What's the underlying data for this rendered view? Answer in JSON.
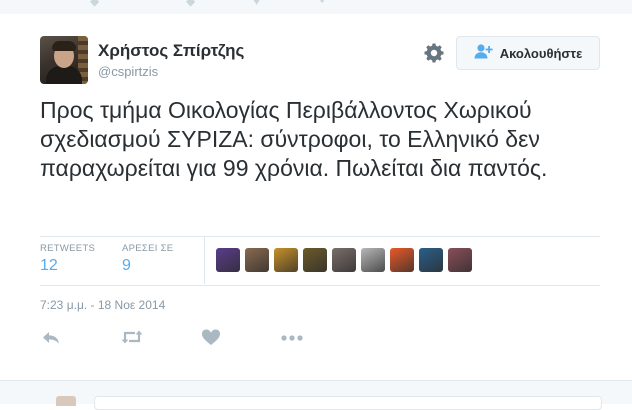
{
  "user": {
    "fullname": "Χρήστος Σπίρτζης",
    "username": "@cspirtzis"
  },
  "follow_button": {
    "label": "Ακολουθήστε"
  },
  "tweet": {
    "text": "Προς τμήμα Οικολογίας Περιβάλλοντος Χωρικού σχεδιασμού ΣΥΡΙΖΑ: σύντροφοι,  το Ελληνικό δεν παραχωρείται για 99 χρόνια. Πωλείται δια παντός.",
    "timestamp": "7:23 μ.μ. - 18 Νοε 2014"
  },
  "stats": {
    "retweets_label": "RETWEETS",
    "retweets_count": "12",
    "likes_label": "ΑΡΕΣΕΙ ΣΕ",
    "likes_count": "9"
  },
  "favoriters": [
    {
      "name": "favoriter-1",
      "color": "#5a3d8a"
    },
    {
      "name": "favoriter-2",
      "color": "#8a6a4f"
    },
    {
      "name": "favoriter-3",
      "color": "#c7902a"
    },
    {
      "name": "favoriter-4",
      "color": "#6b5a2a"
    },
    {
      "name": "favoriter-5",
      "color": "#7a6e6a"
    },
    {
      "name": "favoriter-6",
      "color": "#b8b8b8"
    },
    {
      "name": "favoriter-7",
      "color": "#e85a2a"
    },
    {
      "name": "favoriter-8",
      "color": "#2a5f8a"
    },
    {
      "name": "favoriter-9",
      "color": "#8a4f5a"
    }
  ],
  "actions": [
    "reply-icon",
    "retweet-icon",
    "like-icon",
    "more-icon"
  ],
  "colors": {
    "accent": "#55acee",
    "muted": "#8899a6",
    "text": "#292f33",
    "border": "#e1e8ed"
  }
}
